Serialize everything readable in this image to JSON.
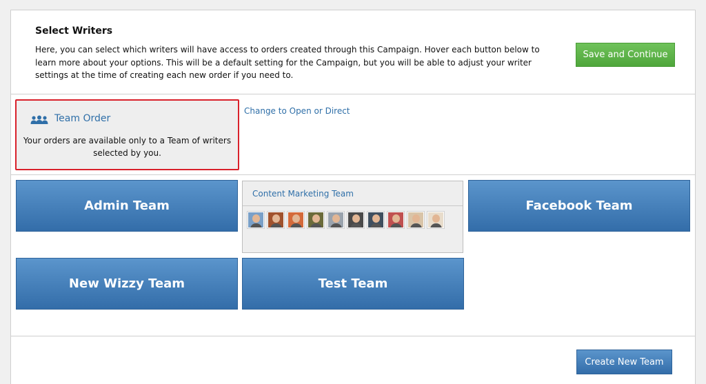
{
  "header": {
    "title": "Select Writers",
    "description": "Here, you can select which writers will have access to orders created through this Campaign. Hover each button below to learn more about your options. This will be a default setting for the Campaign, but you will be able to adjust your writer settings at the time of creating each new order if you need to.",
    "save_label": "Save and Continue"
  },
  "order_type": {
    "icon": "team-icon",
    "label": "Team Order",
    "description": "Your orders are available only to a Team of writers selected by you.",
    "change_link": "Change to Open or Direct"
  },
  "teams": [
    {
      "label": "Admin Team"
    },
    {
      "label": "Content Marketing Team",
      "member_count": 10
    },
    {
      "label": "Facebook Team"
    },
    {
      "label": "New Wizzy Team"
    },
    {
      "label": "Test Team"
    }
  ],
  "footer": {
    "create_label": "Create New Team"
  },
  "colors": {
    "accent_blue": "#336da9",
    "link_blue": "#2f6fa8",
    "save_green": "#5cb349",
    "highlight_red": "#d9202a"
  }
}
